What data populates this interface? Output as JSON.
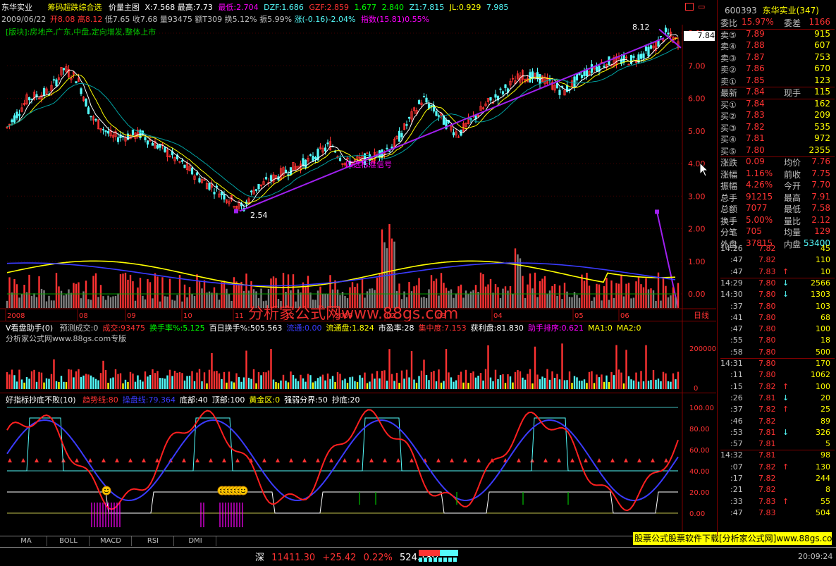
{
  "header": {
    "stock_name": "东华实业",
    "indicator_name": "筹码超跌综合选",
    "chart_kind": "价量主图",
    "x_label": "X:7.568",
    "high_label": "最高:7.73",
    "low_label": "最低:2.704",
    "dzf_label": "DZF:1.686",
    "gzf_label": "GZF:2.859",
    "v1": "1.677",
    "v2": "2.840",
    "z1_label": "Z1:7.815",
    "jl_label": "JL:0.929",
    "v3": "7.985",
    "date": "2009/06/22",
    "open_label": "开8.08",
    "hi_label": "高8.12",
    "lo_label": "低7.65",
    "close_label": "收7.68",
    "vol_label": "量93475",
    "amt_label": "额T309",
    "turn_label": "换5.12%",
    "amp_label": "振5.99%",
    "chg_label": "涨(-0.16)-2.04%",
    "index_label": "指数(15.81)0.55%",
    "sector": "[版块]:房地产,广东,中盘,定向增发,整体上市"
  },
  "main_chart": {
    "price_axis": [
      "8.00",
      "7.00",
      "6.00",
      "5.00",
      "4.00",
      "3.00",
      "2.00",
      "1.00",
      "0.00"
    ],
    "current_price_tag": "7.84",
    "peak_label": "8.12",
    "low_label": "2.54",
    "signal_text": "四选标准信号",
    "watermark": "分析家公式网www.88gs.com",
    "x_labels": [
      "2008",
      "08",
      "09",
      "10",
      "11",
      "12",
      "2009",
      "02",
      "03",
      "04",
      "05",
      "06"
    ],
    "period": "日线",
    "colors": {
      "up": "#ff3232",
      "down": "#54fcfc",
      "ma5": "#ffffff",
      "ma10": "#ffff00",
      "ma20": "#ff00ff",
      "trend": "#a020f0"
    }
  },
  "volume_panel": {
    "title": "V看盘助手(0)",
    "items": [
      "预测成交:0",
      "成交:93475",
      "换手率%:5.125",
      "百日换手%:505.563",
      "流通:0.00",
      "流通盘:1.824",
      "市盈率:28",
      "集中度:7.153",
      "获利盘:81.830",
      "助手排序:0.621",
      "MA1:0",
      "MA2:0"
    ],
    "subtitle": "分析家公式网www.88gs.com专版",
    "axis": [
      "200000",
      "0"
    ]
  },
  "osc_panel": {
    "title": "好指标抄底不败(10)",
    "items": [
      "趋势线:80",
      "操盘线:79.364",
      "底部:40",
      "顶部:100",
      "黄金区:0",
      "强弱分界:50",
      "抄底:20"
    ],
    "axis": [
      "100.00",
      "80.00",
      "60.00",
      "40.00",
      "20.00",
      "0.00"
    ]
  },
  "tabs": [
    "MA",
    "BOLL",
    "MACD",
    "RSI",
    "DMI"
  ],
  "status": {
    "index_name": "深",
    "index_value": "11411.30",
    "index_change": "+25.42",
    "index_pct": "0.22%",
    "index_amount": "524.18亿",
    "ad_text": "股票公式股票软件下载[分析家公式网]www.88gs.com",
    "time": "20:09:24"
  },
  "right_panel": {
    "code": "600393",
    "name": "东华实业(347)",
    "webi_label": "委比",
    "webi_value": "15.97%",
    "weic_label": "委差",
    "weic_value": "1166",
    "asks": [
      {
        "label": "卖⑤",
        "price": "7.89",
        "vol": "915"
      },
      {
        "label": "卖④",
        "price": "7.88",
        "vol": "607"
      },
      {
        "label": "卖③",
        "price": "7.87",
        "vol": "753"
      },
      {
        "label": "卖②",
        "price": "7.86",
        "vol": "670"
      },
      {
        "label": "卖①",
        "price": "7.85",
        "vol": "123"
      }
    ],
    "latest_label": "最新",
    "latest_value": "7.84",
    "xianshou_label": "现手",
    "xianshou_value": "115",
    "bids": [
      {
        "label": "买①",
        "price": "7.84",
        "vol": "162"
      },
      {
        "label": "买②",
        "price": "7.83",
        "vol": "209"
      },
      {
        "label": "买③",
        "price": "7.82",
        "vol": "535"
      },
      {
        "label": "买④",
        "price": "7.81",
        "vol": "972"
      },
      {
        "label": "买⑤",
        "price": "7.80",
        "vol": "2355"
      }
    ],
    "stats": [
      {
        "l1": "涨跌",
        "v1": "0.09",
        "l2": "均价",
        "v2": "7.76"
      },
      {
        "l1": "涨幅",
        "v1": "1.16%",
        "l2": "前收",
        "v2": "7.75"
      },
      {
        "l1": "振幅",
        "v1": "4.26%",
        "l2": "今开",
        "v2": "7.70"
      },
      {
        "l1": "总手",
        "v1": "91215",
        "l2": "最高",
        "v2": "7.91"
      },
      {
        "l1": "总额",
        "v1": "7077",
        "l2": "最低",
        "v2": "7.58"
      },
      {
        "l1": "换手",
        "v1": "5.00%",
        "l2": "量比",
        "v2": "2.12"
      },
      {
        "l1": "分笔",
        "v1": "705",
        "l2": "均量",
        "v2": "129"
      }
    ],
    "waipan_label": "外盘",
    "waipan_value": "37815",
    "neipan_label": "内盘",
    "neipan_value": "53400",
    "ticks": [
      {
        "t": "14:26",
        "p": "7.82",
        "a": "",
        "v": "45"
      },
      {
        "t": ":47",
        "p": "7.82",
        "a": "",
        "v": "110"
      },
      {
        "t": ":47",
        "p": "7.83",
        "a": "↑",
        "v": "10"
      },
      {
        "t": "14:29",
        "p": "7.80",
        "a": "↓",
        "v": "2566"
      },
      {
        "t": "14:30",
        "p": "7.80",
        "a": "↓",
        "v": "1303"
      },
      {
        "t": ":37",
        "p": "7.80",
        "a": "",
        "v": "103"
      },
      {
        "t": ":41",
        "p": "7.80",
        "a": "",
        "v": "68"
      },
      {
        "t": ":47",
        "p": "7.80",
        "a": "",
        "v": "100"
      },
      {
        "t": ":55",
        "p": "7.80",
        "a": "",
        "v": "18"
      },
      {
        "t": ":58",
        "p": "7.80",
        "a": "",
        "v": "500"
      },
      {
        "t": "14:31",
        "p": "7.80",
        "a": "",
        "v": "170"
      },
      {
        "t": ":11",
        "p": "7.80",
        "a": "",
        "v": "1062"
      },
      {
        "t": ":15",
        "p": "7.82",
        "a": "↑",
        "v": "100"
      },
      {
        "t": ":26",
        "p": "7.81",
        "a": "↓",
        "v": "20"
      },
      {
        "t": ":37",
        "p": "7.82",
        "a": "↑",
        "v": "25"
      },
      {
        "t": ":46",
        "p": "7.82",
        "a": "",
        "v": "89"
      },
      {
        "t": ":53",
        "p": "7.81",
        "a": "↓",
        "v": "326"
      },
      {
        "t": ":57",
        "p": "7.81",
        "a": "",
        "v": "5"
      },
      {
        "t": "14:32",
        "p": "7.81",
        "a": "",
        "v": "98"
      },
      {
        "t": ":07",
        "p": "7.82",
        "a": "↑",
        "v": "130"
      },
      {
        "t": ":17",
        "p": "7.82",
        "a": "",
        "v": "244"
      },
      {
        "t": ":21",
        "p": "7.82",
        "a": "",
        "v": "8"
      },
      {
        "t": ":33",
        "p": "7.83",
        "a": "↑",
        "v": "55"
      },
      {
        "t": ":47",
        "p": "7.83",
        "a": "",
        "v": "504"
      }
    ]
  }
}
